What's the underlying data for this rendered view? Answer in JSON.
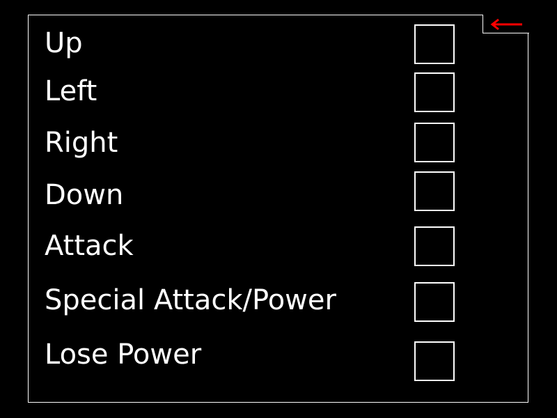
{
  "controls": [
    {
      "action": "Up",
      "key": ""
    },
    {
      "action": "Left",
      "key": ""
    },
    {
      "action": "Right",
      "key": ""
    },
    {
      "action": "Down",
      "key": ""
    },
    {
      "action": "Attack",
      "key": ""
    },
    {
      "action": "Special Attack/Power",
      "key": ""
    },
    {
      "action": "Lose Power",
      "key": ""
    }
  ],
  "back_button": {
    "icon": "arrow-left-icon",
    "color": "#ff0000"
  },
  "colors": {
    "background": "#000000",
    "foreground": "#ffffff",
    "accent": "#ff0000"
  }
}
